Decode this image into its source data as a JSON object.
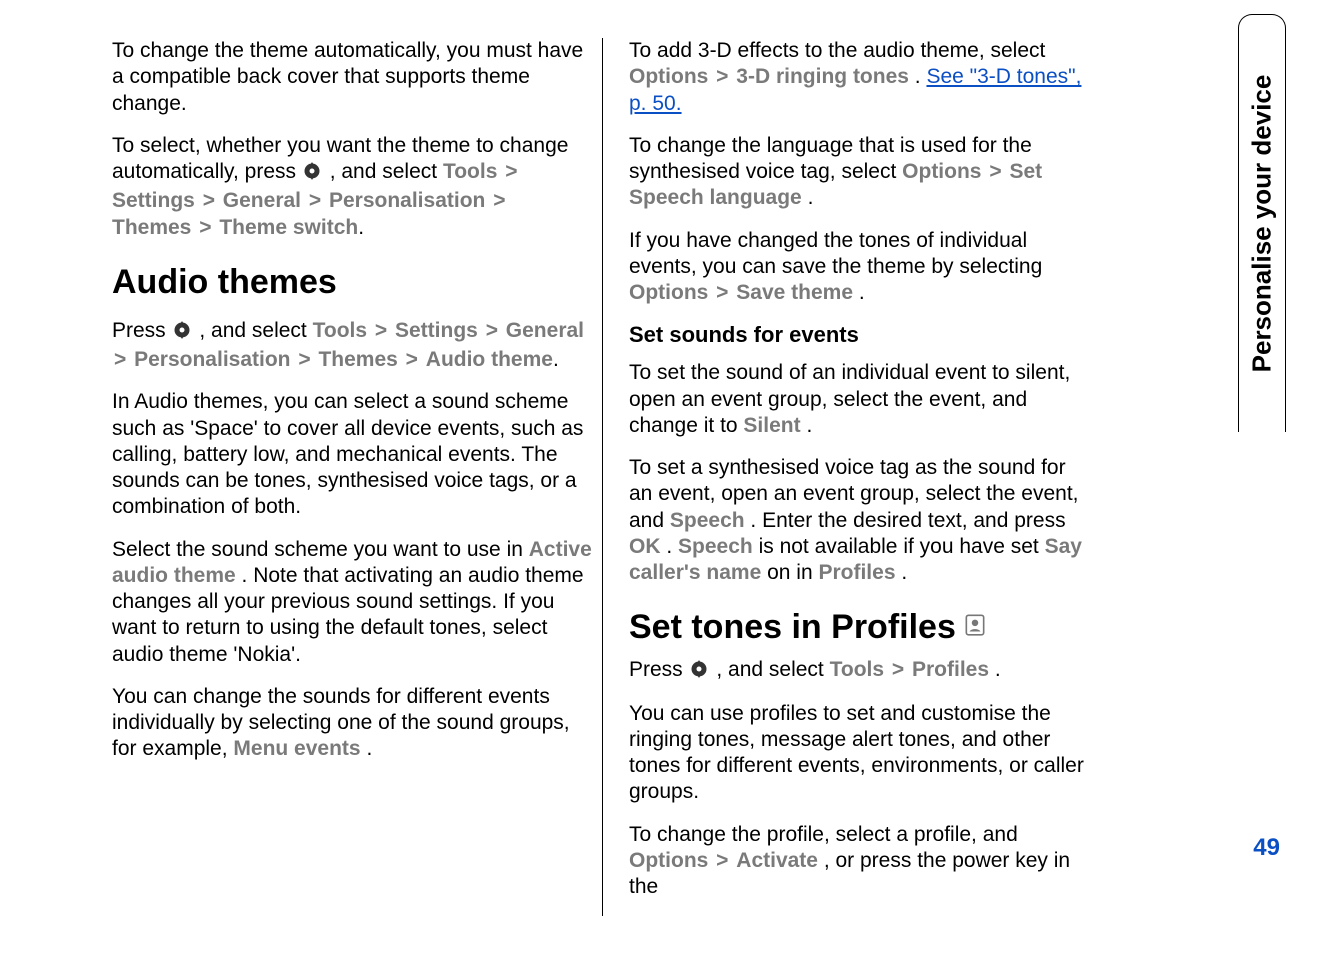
{
  "side_tab": "Personalise your device",
  "page_number": "49",
  "col1": {
    "p1_a": "To change the theme automatically, you must have a compatible back cover that supports theme change.",
    "p2_a": "To select, whether you want the theme to change automatically, press ",
    "p2_b": " , and select ",
    "p2_tools": "Tools",
    "p2_settings": "Settings",
    "p2_general": "General",
    "p2_personalisation": "Personalisation",
    "p2_themes": "Themes",
    "p2_theme_switch": "Theme switch",
    "h2_audio": "Audio themes",
    "p3_a": "Press ",
    "p3_b": " , and select ",
    "p3_tools": "Tools",
    "p3_settings": "Settings",
    "p3_general": "General",
    "p3_personalisation": "Personalisation",
    "p3_themes": "Themes",
    "p3_audio_theme": "Audio theme",
    "p4": "In Audio themes, you can select a sound scheme such as 'Space' to cover all device events, such as calling, battery low, and mechanical events. The sounds can be tones, synthesised voice tags, or a combination of both.",
    "p5_a": "Select the sound scheme you want to use in ",
    "p5_active": "Active audio theme",
    "p5_b": ". Note that activating an audio theme changes all your previous sound settings. If you want to return to using the default tones, select audio theme 'Nokia'.",
    "p6_a": "You can change the sounds for different events individually by selecting one of the sound groups, for example, ",
    "p6_menu_events": "Menu events",
    "p6_b": "."
  },
  "col2": {
    "p1_a": "To add 3-D effects to the audio theme, select ",
    "p1_options": "Options",
    "p1_3d": "3-D ringing tones",
    "p1_b": ". ",
    "p1_link": "See \"3-D tones\", p. 50.",
    "p2_a": "To change the language that is used for the synthesised voice tag, select ",
    "p2_options": "Options",
    "p2_set_speech": "Set Speech language",
    "p2_b": ".",
    "p3_a": "If you have changed the tones of individual events, you can save the theme by selecting ",
    "p3_options": "Options",
    "p3_save_theme": "Save theme",
    "p3_b": ".",
    "h3_set_sounds": "Set sounds for events",
    "p4_a": "To set the sound of an individual event to silent, open an event group, select the event, and change it to ",
    "p4_silent": "Silent",
    "p4_b": ".",
    "p5_a": "To set a synthesised voice tag as the sound for an event, open an event group, select the event, and ",
    "p5_speech1": "Speech",
    "p5_b": ". Enter the desired text, and press ",
    "p5_ok": "OK",
    "p5_c": ". ",
    "p5_speech2": "Speech",
    "p5_d": " is not available if you have set ",
    "p5_say": "Say caller's name",
    "p5_e": " on in ",
    "p5_profiles": "Profiles",
    "p5_f": ".",
    "h2_set_tones": "Set tones in Profiles",
    "p6_a": "Press ",
    "p6_b": " , and select ",
    "p6_tools": "Tools",
    "p6_profiles": "Profiles",
    "p6_c": ".",
    "p7": "You can use profiles to set and customise the ringing tones, message alert tones, and other tones for different events, environments, or caller groups.",
    "p8_a": "To change the profile, select a profile, and ",
    "p8_options": "Options",
    "p8_activate": "Activate",
    "p8_b": ", or press the power key in the"
  },
  "gt": ">"
}
